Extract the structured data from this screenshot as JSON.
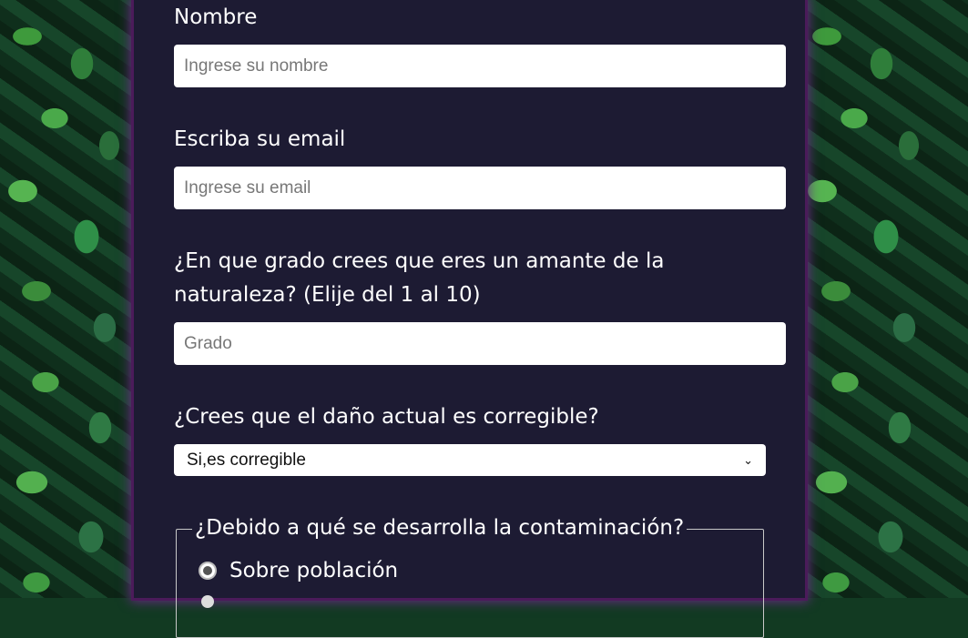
{
  "form": {
    "name": {
      "label": "Nombre",
      "placeholder": "Ingrese su nombre"
    },
    "email": {
      "label": "Escriba su email",
      "placeholder": "Ingrese su email"
    },
    "grade": {
      "label_line1": "¿En que grado crees que eres un amante de la",
      "label_line2": "naturaleza? (Elije del 1 al 10)",
      "placeholder": "Grado"
    },
    "damage": {
      "label": "¿Crees que el daño actual es corregible?",
      "selected": "Si,es corregible"
    },
    "cause": {
      "legend": "¿Debido a qué se desarrolla la contaminación?",
      "options": [
        "Sobre población"
      ]
    }
  },
  "colors": {
    "panel": "#1d1b33",
    "border_glow": "#6a2a86"
  }
}
